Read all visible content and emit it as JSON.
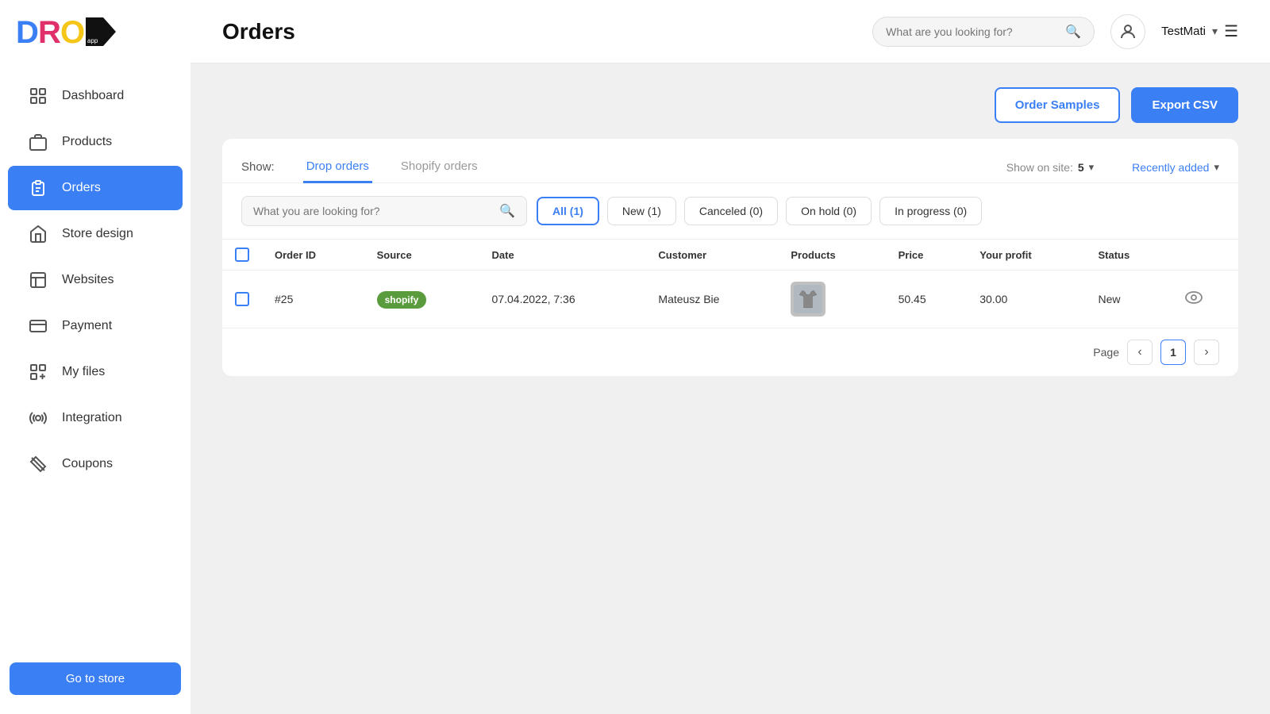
{
  "sidebar": {
    "logo_alt": "Drop App Logo",
    "nav_items": [
      {
        "id": "dashboard",
        "label": "Dashboard",
        "icon": "dashboard-icon",
        "active": false
      },
      {
        "id": "products",
        "label": "Products",
        "icon": "products-icon",
        "active": false
      },
      {
        "id": "orders",
        "label": "Orders",
        "icon": "orders-icon",
        "active": true
      },
      {
        "id": "store-design",
        "label": "Store design",
        "icon": "store-design-icon",
        "active": false
      },
      {
        "id": "websites",
        "label": "Websites",
        "icon": "websites-icon",
        "active": false
      },
      {
        "id": "payment",
        "label": "Payment",
        "icon": "payment-icon",
        "active": false
      },
      {
        "id": "my-files",
        "label": "My files",
        "icon": "my-files-icon",
        "active": false
      },
      {
        "id": "integration",
        "label": "Integration",
        "icon": "integration-icon",
        "active": false
      },
      {
        "id": "coupons",
        "label": "Coupons",
        "icon": "coupons-icon",
        "active": false
      }
    ],
    "go_to_store": "Go to store"
  },
  "header": {
    "title": "Orders",
    "search_placeholder": "What are you looking for?",
    "username": "TestMati"
  },
  "actions": {
    "order_samples": "Order Samples",
    "export_csv": "Export CSV"
  },
  "tabs": {
    "show_label": "Show:",
    "items": [
      {
        "id": "drop-orders",
        "label": "Drop orders",
        "active": true
      },
      {
        "id": "shopify-orders",
        "label": "Shopify orders",
        "active": false
      }
    ],
    "show_on_site_label": "Show on site:",
    "show_on_site_value": "5",
    "recently_added": "Recently added"
  },
  "filters": {
    "search_placeholder": "What you are looking for?",
    "buttons": [
      {
        "id": "all",
        "label": "All (1)",
        "active": true
      },
      {
        "id": "new",
        "label": "New (1)",
        "active": false
      },
      {
        "id": "canceled",
        "label": "Canceled (0)",
        "active": false
      },
      {
        "id": "on-hold",
        "label": "On hold (0)",
        "active": false
      },
      {
        "id": "in-progress",
        "label": "In progress (0)",
        "active": false
      }
    ]
  },
  "table": {
    "columns": [
      {
        "id": "checkbox",
        "label": ""
      },
      {
        "id": "order-id",
        "label": "Order ID"
      },
      {
        "id": "source",
        "label": "Source"
      },
      {
        "id": "date",
        "label": "Date"
      },
      {
        "id": "customer",
        "label": "Customer"
      },
      {
        "id": "products",
        "label": "Products"
      },
      {
        "id": "price",
        "label": "Price"
      },
      {
        "id": "profit",
        "label": "Your profit"
      },
      {
        "id": "status",
        "label": "Status"
      },
      {
        "id": "actions",
        "label": ""
      }
    ],
    "rows": [
      {
        "order_id": "#25",
        "source": "shopify",
        "date": "07.04.2022, 7:36",
        "customer": "Mateusz Bie",
        "price": "50.45",
        "profit": "30.00",
        "status": "New"
      }
    ]
  },
  "pagination": {
    "label": "Page",
    "current": "1"
  }
}
